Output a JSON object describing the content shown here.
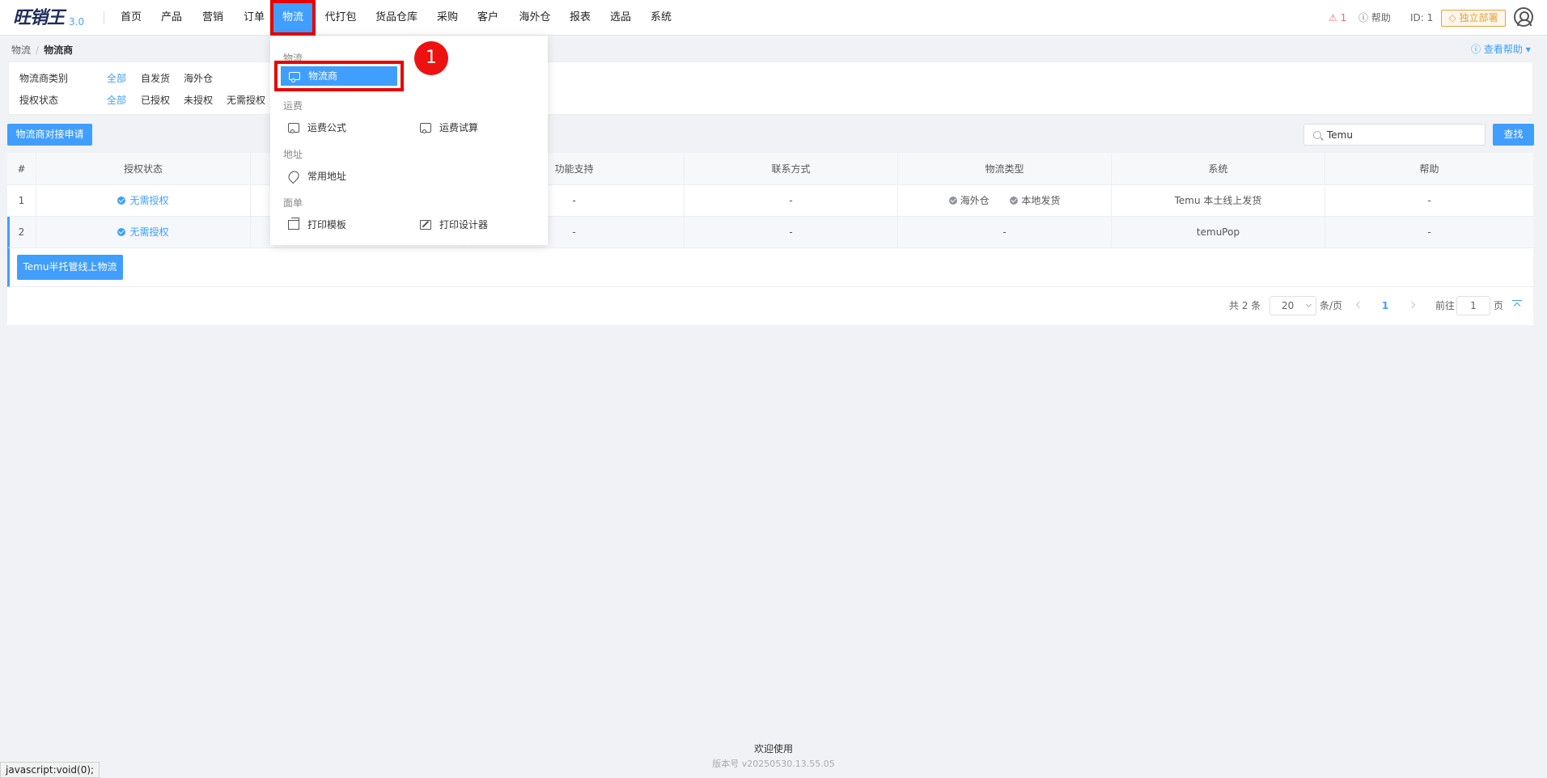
{
  "header": {
    "logo": "旺销王",
    "version": "3.0",
    "nav": [
      "首页",
      "产品",
      "营销",
      "订单",
      "物流",
      "代打包",
      "货品仓库",
      "采购",
      "客户",
      "海外仓",
      "报表",
      "选品",
      "系统"
    ],
    "warning_count": "1",
    "help": "帮助",
    "id_label": "ID: 1",
    "deploy": "独立部署"
  },
  "breadcrumb": {
    "root": "物流",
    "current": "物流商"
  },
  "help_link": "查看帮助",
  "filters": {
    "category_label": "物流商类别",
    "category_options": [
      "全部",
      "自发货",
      "海外仓"
    ],
    "auth_label": "授权状态",
    "auth_options": [
      "全部",
      "已授权",
      "未授权",
      "无需授权"
    ]
  },
  "actions": {
    "apply": "物流商对接申请",
    "search_value": "Temu",
    "query": "查找"
  },
  "table": {
    "columns": [
      "#",
      "授权状态",
      "功能支持",
      "联系方式",
      "物流类型",
      "系统",
      "帮助"
    ],
    "rows": [
      {
        "index": "1",
        "auth": "无需授权",
        "features": "-",
        "contact": "-",
        "types": [
          "海外仓",
          "本地发货"
        ],
        "system": "Temu 本土线上发货",
        "help": "-"
      },
      {
        "index": "2",
        "auth": "无需授权",
        "features": "-",
        "contact": "-",
        "types_text": "-",
        "system": "temuPop",
        "help": "-"
      }
    ],
    "expanded_button": "Temu半托管线上物流"
  },
  "pagination": {
    "total": "共 2 条",
    "page_size": "20",
    "per_page": "条/页",
    "current": "1",
    "goto": "前往",
    "goto_value": "1",
    "page_unit": "页"
  },
  "dropdown": {
    "group_logistics": "物流",
    "item_carrier": "物流商",
    "group_freight": "运费",
    "item_formula": "运费公式",
    "item_trial": "运费试算",
    "group_address": "地址",
    "item_address": "常用地址",
    "group_form": "面单",
    "item_template": "打印模板",
    "item_designer": "打印设计器",
    "step_badge": "1"
  },
  "footer": {
    "welcome": "欢迎使用",
    "version": "版本号 v20250530.13.55.05"
  },
  "status_bar": "javascript:void(0);"
}
